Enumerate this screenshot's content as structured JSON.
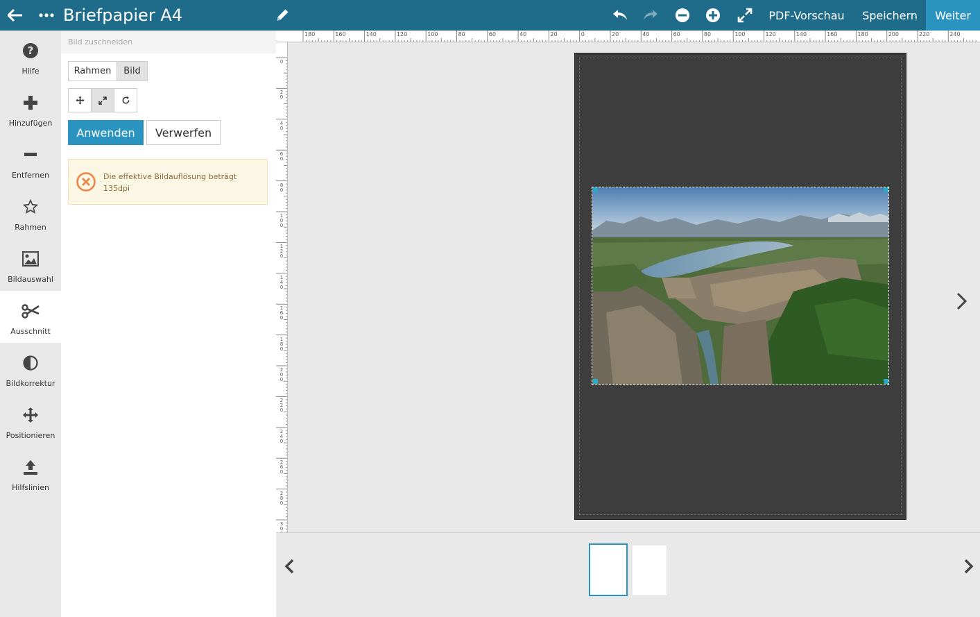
{
  "header": {
    "title": "Briefpapier A4",
    "pdf_preview": "PDF-Vorschau",
    "save": "Speichern",
    "next": "Weiter"
  },
  "sidebar": {
    "items": [
      {
        "label": "Hilfe",
        "icon": "help-icon"
      },
      {
        "label": "Hinzufügen",
        "icon": "plus-icon"
      },
      {
        "label": "Entfernen",
        "icon": "minus-icon"
      },
      {
        "label": "Rahmen",
        "icon": "star-icon"
      },
      {
        "label": "Bildauswahl",
        "icon": "image-icon"
      },
      {
        "label": "Ausschnitt",
        "icon": "scissors-icon"
      },
      {
        "label": "Bildkorrektur",
        "icon": "contrast-icon"
      },
      {
        "label": "Positionieren",
        "icon": "move-icon"
      },
      {
        "label": "Hilfslinien",
        "icon": "upload-icon"
      }
    ],
    "active": "Ausschnitt"
  },
  "panel": {
    "heading": "Bild zuschneiden",
    "segment": {
      "frame": "Rahmen",
      "image": "Bild",
      "selected": "Bild"
    },
    "tools": [
      "move-icon",
      "resize-icon",
      "rotate-icon"
    ],
    "apply": "Anwenden",
    "discard": "Verwerfen",
    "warning": "Die effektive Bildauflösung beträgt 135dpi"
  },
  "ruler": {
    "top": [
      "180",
      "160",
      "140",
      "120",
      "100",
      "80",
      "60",
      "40",
      "20",
      "0",
      "20",
      "40",
      "60",
      "80",
      "100",
      "120",
      "140",
      "160",
      "180",
      "200",
      "220",
      "240"
    ],
    "left": [
      "0",
      "20",
      "40",
      "60",
      "80",
      "100",
      "120",
      "140",
      "160",
      "180",
      "200",
      "220",
      "240",
      "260",
      "280",
      "300"
    ]
  },
  "colors": {
    "topbar": "#1f6b8a",
    "accent": "#2b93bf",
    "page": "#3d3d3d",
    "warning_bg": "#fcf6e5",
    "warning_icon": "#e8884a"
  }
}
